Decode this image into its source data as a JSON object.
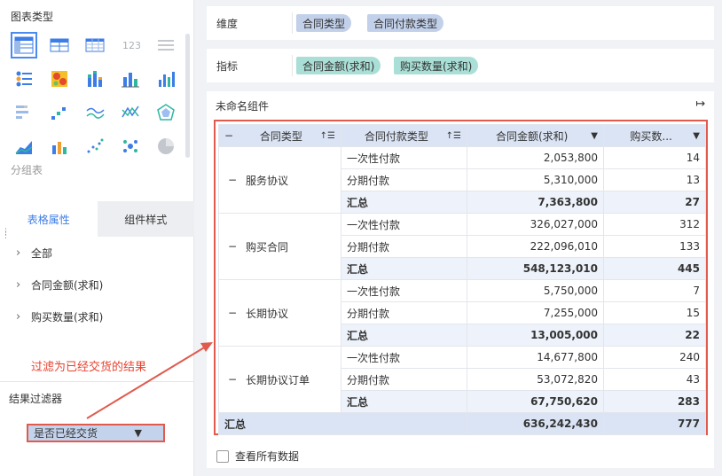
{
  "left": {
    "chart_types_title": "图表类型",
    "group_table_label": "分组表",
    "tabs": [
      {
        "label": "表格属性",
        "active": true
      },
      {
        "label": "组件样式",
        "active": false
      }
    ],
    "properties": [
      "全部",
      "合同金额(求和)",
      "购买数量(求和)"
    ],
    "annotation": "过滤为已经交货的结果",
    "filter_title": "结果过滤器",
    "filter_pill": "是否已经交货"
  },
  "dimension": {
    "label": "维度",
    "chips": [
      "合同类型",
      "合同付款类型"
    ]
  },
  "metric": {
    "label": "指标",
    "chips": [
      "合同金额(求和)",
      "购买数量(求和)"
    ]
  },
  "component": {
    "title": "未命名组件"
  },
  "table": {
    "headers": [
      "合同类型",
      "合同付款类型",
      "合同金额(求和)",
      "购买数..."
    ],
    "groups": [
      {
        "name": "服务协议",
        "rows": [
          [
            "一次性付款",
            "2,053,800",
            "14"
          ],
          [
            "分期付款",
            "5,310,000",
            "13"
          ]
        ],
        "total": [
          "汇总",
          "7,363,800",
          "27"
        ]
      },
      {
        "name": "购买合同",
        "rows": [
          [
            "一次性付款",
            "326,027,000",
            "312"
          ],
          [
            "分期付款",
            "222,096,010",
            "133"
          ]
        ],
        "total": [
          "汇总",
          "548,123,010",
          "445"
        ]
      },
      {
        "name": "长期协议",
        "rows": [
          [
            "一次性付款",
            "5,750,000",
            "7"
          ],
          [
            "分期付款",
            "7,255,000",
            "15"
          ]
        ],
        "total": [
          "汇总",
          "13,005,000",
          "22"
        ]
      },
      {
        "name": "长期协议订单",
        "rows": [
          [
            "一次性付款",
            "14,677,800",
            "240"
          ],
          [
            "分期付款",
            "53,072,820",
            "43"
          ]
        ],
        "total": [
          "汇总",
          "67,750,620",
          "283"
        ]
      }
    ],
    "grand_total": [
      "汇总",
      "636,242,430",
      "777"
    ]
  },
  "show_all_data_label": "查看所有数据",
  "colors": {
    "accent": "#3d7de6",
    "highlight": "#e05a4e",
    "dimension_chip": "#c2d0ea",
    "metric_chip": "#a9dfd6",
    "header_bg": "#dbe4f4"
  }
}
